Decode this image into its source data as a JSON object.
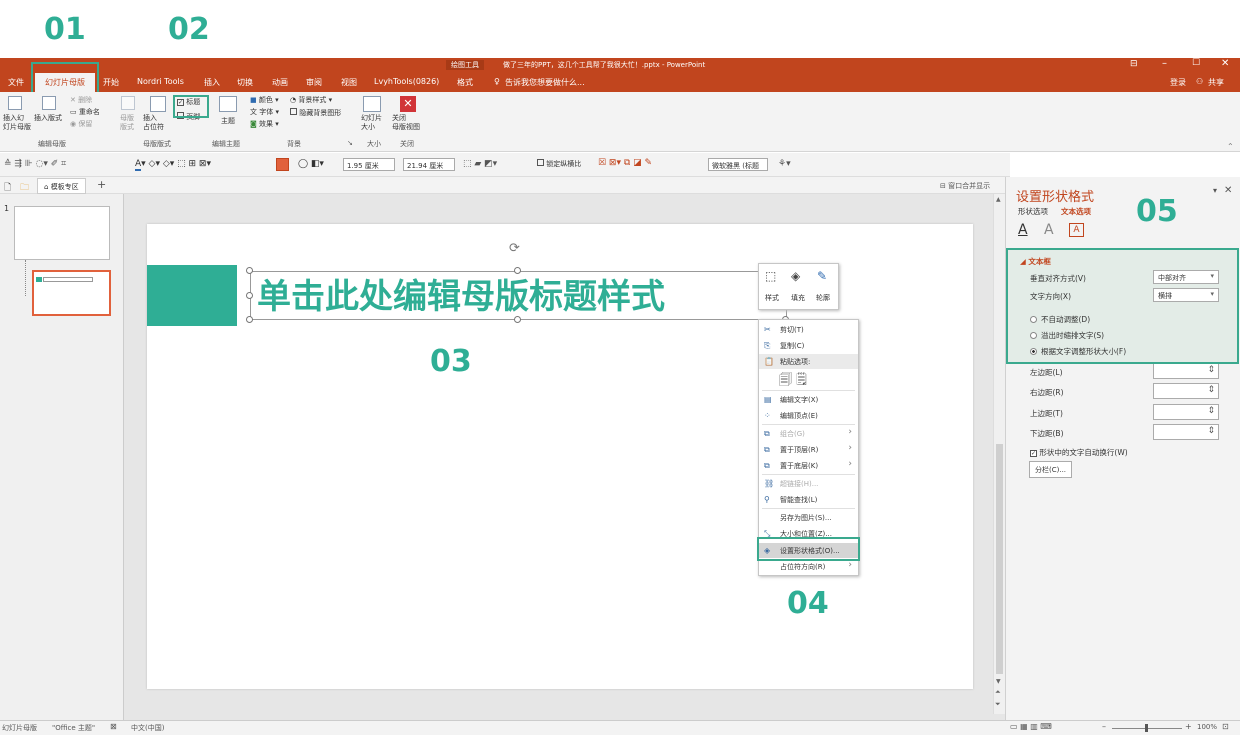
{
  "annotations": [
    "01",
    "02",
    "03",
    "04",
    "05"
  ],
  "titlebar": {
    "tool_context": "绘图工具",
    "title": "做了三年的PPT，这几个工具帮了我很大忙！.pptx - PowerPoint"
  },
  "tabs": [
    {
      "label": "文件"
    },
    {
      "label": "幻灯片母版"
    },
    {
      "label": "开始"
    },
    {
      "label": "Nordri Tools"
    },
    {
      "label": "插入"
    },
    {
      "label": "切换"
    },
    {
      "label": "动画"
    },
    {
      "label": "审阅"
    },
    {
      "label": "视图"
    },
    {
      "label": "LvyhTools(0826)"
    },
    {
      "label": "格式"
    }
  ],
  "tell_me": "告诉我您想要做什么...",
  "account": {
    "login": "登录",
    "share": "共享"
  },
  "ribbon": {
    "insert_master": "插入幻\n灯片母版",
    "insert_layout": "插入版式",
    "delete": "删除",
    "rename": "重命名",
    "preserve": "保留",
    "master_layout": "母版\n版式",
    "insert_placeholder": "插入\n占位符",
    "title_checkbox": "标题",
    "footer_checkbox": "页脚",
    "themes": "主题",
    "colors": "颜色",
    "fonts": "字体",
    "effects": "效果",
    "bg_styles": "背景样式",
    "hide_bg": "隐藏背景图形",
    "slide_size": "幻灯片\n大小",
    "close_master": "关闭\n母版视图",
    "groups": {
      "edit_master": "编辑母版",
      "master_layout": "母版版式",
      "edit_theme": "编辑主题",
      "background": "背景",
      "size": "大小",
      "close": "关闭"
    }
  },
  "format_toolbar": {
    "width": "1.95 厘米",
    "height": "21.94 厘米",
    "lock_ratio": "锁定纵横比",
    "font": "微软雅黑 (标题"
  },
  "tabstrip": {
    "templates": "模板专区",
    "merge_windows": "窗口合并显示"
  },
  "slides": [
    {
      "number": "1"
    }
  ],
  "slide": {
    "title_placeholder": "单击此处编辑母版标题样式"
  },
  "mini_toolbar": {
    "style": "样式",
    "fill": "填充",
    "outline": "轮廓"
  },
  "context_menu": {
    "items": [
      {
        "label": "剪切(T)",
        "icon": "✂",
        "disabled": false,
        "submenu": false
      },
      {
        "label": "复制(C)",
        "icon": "⎘",
        "disabled": false,
        "submenu": false
      },
      {
        "label": "粘贴选项:",
        "icon": "📋",
        "disabled": false,
        "submenu": false
      },
      {
        "label": "编辑文字(X)",
        "icon": "▤",
        "disabled": false,
        "submenu": false
      },
      {
        "label": "编辑顶点(E)",
        "icon": "⁘",
        "disabled": false,
        "submenu": false
      },
      {
        "label": "组合(G)",
        "icon": "⧉",
        "disabled": true,
        "submenu": true
      },
      {
        "label": "置于顶层(R)",
        "icon": "⧉",
        "disabled": false,
        "submenu": true
      },
      {
        "label": "置于底层(K)",
        "icon": "⧉",
        "disabled": false,
        "submenu": true
      },
      {
        "label": "超链接(H)...",
        "icon": "⛓",
        "disabled": true,
        "submenu": false
      },
      {
        "label": "智能查找(L)",
        "icon": "⚲",
        "disabled": false,
        "submenu": false
      },
      {
        "label": "另存为图片(S)...",
        "icon": "",
        "disabled": false,
        "submenu": false
      },
      {
        "label": "大小和位置(Z)...",
        "icon": "⤡",
        "disabled": false,
        "submenu": false
      },
      {
        "label": "设置形状格式(O)...",
        "icon": "◈",
        "disabled": false,
        "submenu": false
      },
      {
        "label": "占位符方向(R)",
        "icon": "",
        "disabled": false,
        "submenu": true
      }
    ]
  },
  "format_pane": {
    "title": "设置形状格式",
    "tab_shape": "形状选项",
    "tab_text": "文本选项",
    "section": "文本框",
    "valign_label": "垂直对齐方式(V)",
    "valign_value": "中部对齐",
    "direction_label": "文字方向(X)",
    "direction_value": "横排",
    "autofit": [
      "不自动调整(D)",
      "溢出时缩排文字(S)",
      "根据文字调整形状大小(F)"
    ],
    "autofit_selected": 2,
    "margin_left": "左边距(L)",
    "margin_right": "右边距(R)",
    "margin_top": "上边距(T)",
    "margin_bottom": "下边距(B)",
    "wrap": "形状中的文字自动换行(W)",
    "columns": "分栏(C)..."
  },
  "statusbar": {
    "view": "幻灯片母版",
    "theme": "\"Office 主题\"",
    "language": "中文(中国)",
    "zoom": "100%"
  },
  "colors": {
    "accent": "#c1451e",
    "teal": "#2fae95"
  }
}
